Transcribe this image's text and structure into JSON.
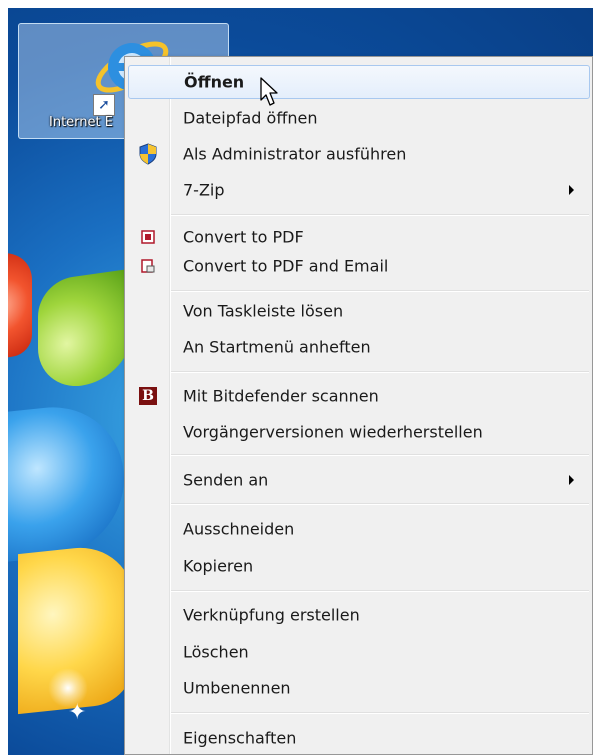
{
  "desktop": {
    "icon_label": "Internet E",
    "icon_name": "internet-explorer-icon"
  },
  "context_menu": {
    "items": [
      {
        "label": "Öffnen",
        "bold": true,
        "hover": true
      },
      {
        "label": "Dateipfad öffnen"
      },
      {
        "label": "Als Administrator ausführen",
        "icon": "uac-shield-icon"
      },
      {
        "label": "7-Zip",
        "submenu": true
      },
      {
        "label": "Convert to PDF",
        "icon": "pdf-convert-icon"
      },
      {
        "label": "Convert to PDF and Email",
        "icon": "pdf-email-icon"
      },
      {
        "label": "Von Taskleiste lösen"
      },
      {
        "label": "An Startmenü anheften"
      },
      {
        "label": "Mit Bitdefender scannen",
        "icon": "bitdefender-icon"
      },
      {
        "label": "Vorgängerversionen wiederherstellen"
      },
      {
        "label": "Senden an",
        "submenu": true
      },
      {
        "label": "Ausschneiden"
      },
      {
        "label": "Kopieren"
      },
      {
        "label": "Verknüpfung erstellen"
      },
      {
        "label": "Löschen"
      },
      {
        "label": "Umbenennen"
      },
      {
        "label": "Eigenschaften"
      }
    ],
    "bitdefender_letter": "B"
  },
  "colors": {
    "hover_border": "#a8c8ef",
    "menu_background": "#f0f0f0",
    "desktop_blue": "#1a6fc2"
  }
}
